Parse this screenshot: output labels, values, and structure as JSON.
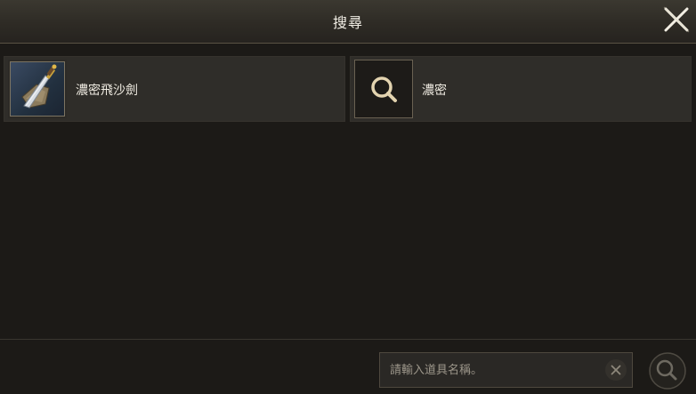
{
  "header": {
    "title": "搜尋"
  },
  "results": [
    {
      "label": "濃密飛沙劍",
      "icon": "dagger-item-icon"
    },
    {
      "label": "濃密",
      "icon": "search-icon"
    }
  ],
  "search": {
    "placeholder": "請輸入道具名稱。",
    "value": ""
  },
  "colors": {
    "background": "#1c1a17",
    "card": "#2f2d29",
    "accent": "#d8c9a3"
  }
}
